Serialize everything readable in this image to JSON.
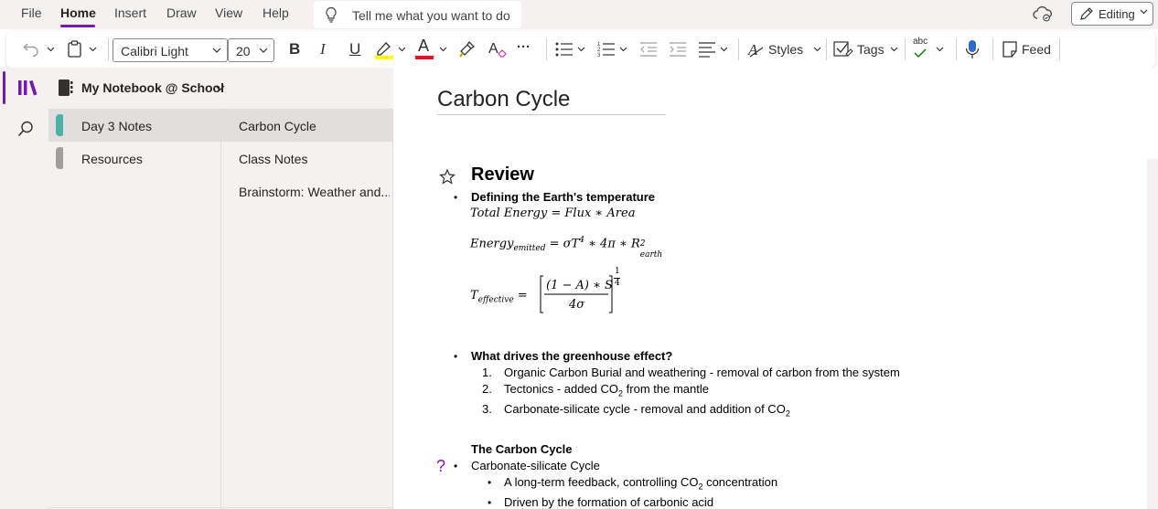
{
  "menu": {
    "items": [
      "File",
      "Home",
      "Insert",
      "Draw",
      "View",
      "Help"
    ],
    "active": "Home",
    "tell_me": "Tell me what you want to do",
    "editing_label": "Editing"
  },
  "ribbon": {
    "font_name": "Calibri Light",
    "font_size": "20",
    "bold": "B",
    "italic": "I",
    "underline": "U",
    "font_color_glyph": "A",
    "styles_label": "Styles",
    "tags_label": "Tags",
    "spelling_glyph": "abc",
    "feed_label": "Feed",
    "more_glyph": "···",
    "colors": {
      "highlight": "#ffff00",
      "font_color": "#e81123",
      "accent": "#7719aa"
    }
  },
  "notebook": {
    "name": "My Notebook @ School",
    "sections": [
      {
        "label": "Day 3 Notes",
        "color": "#4bb3a5",
        "selected": true
      },
      {
        "label": "Resources",
        "color": "#a19f9d",
        "selected": false
      }
    ],
    "pages": [
      {
        "label": "Carbon Cycle",
        "selected": true
      },
      {
        "label": "Class Notes",
        "selected": false
      },
      {
        "label": "Brainstorm: Weather and...",
        "selected": false
      }
    ]
  },
  "page": {
    "title": "Carbon Cycle",
    "review_heading": "Review",
    "bullet1": "Defining the Earth's temperature",
    "eq1": {
      "lhs": "Total Energy",
      "eq": "=",
      "rhs_a": "Flux",
      "op": "∗",
      "rhs_b": "Area"
    },
    "eq2": {
      "sym": "Energy",
      "sub": "emitted",
      "eq": "= σT",
      "pow": "4",
      "mid": " ∗ 4π ∗ R",
      "sup": "2",
      "sub2": "earth"
    },
    "eq3": {
      "sym": "T",
      "sub": "effective",
      "eq": "=",
      "numerator": "(1 − A) ∗ S",
      "denominator": "4σ",
      "exp_num": "1",
      "exp_den": "4"
    },
    "bullet2": "What drives the greenhouse effect?",
    "list": [
      {
        "num": "1.",
        "text": "Organic Carbon Burial and weathering - removal of carbon from the system"
      },
      {
        "num": "2.",
        "text_a": "Tectonics - added CO",
        "sub": "2",
        "text_b": " from the mantle"
      },
      {
        "num": "3.",
        "text_a": "Carbonate-silicate cycle - removal and addition of CO",
        "sub": "2"
      }
    ],
    "carbon_heading": "The Carbon Cycle",
    "bullet3": "Carbonate-silicate Cycle",
    "question_tag": "?",
    "sub_bullets": [
      {
        "text_a": "A long-term feedback, controlling CO",
        "sub": "2",
        "text_b": " concentration"
      },
      {
        "text_a": "Driven by the formation of carbonic acid"
      }
    ]
  }
}
